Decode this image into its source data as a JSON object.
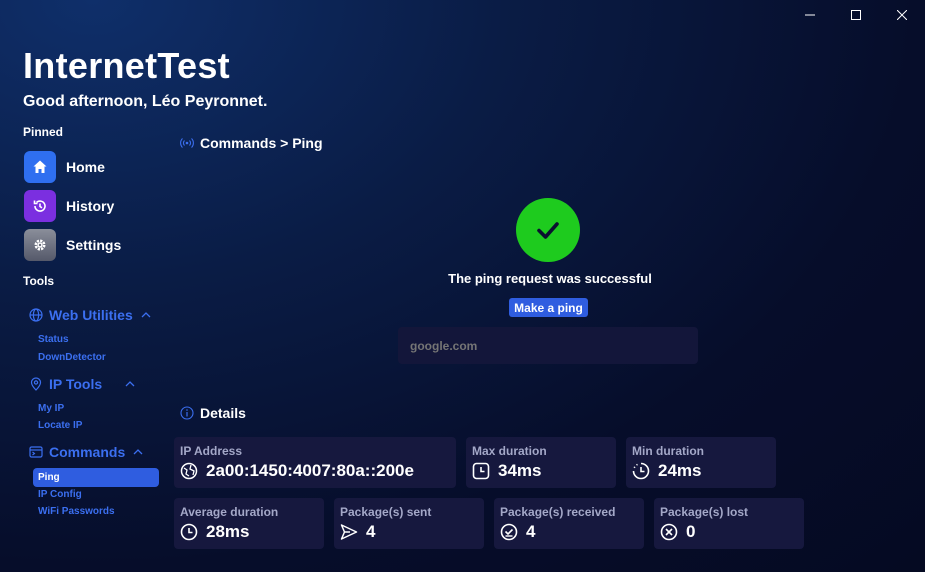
{
  "window": {
    "minimize_icon": "minimize-icon",
    "maximize_icon": "maximize-icon",
    "close_icon": "close-icon"
  },
  "app": {
    "title": "InternetTest",
    "greeting": "Good afternoon, Léo Peyronnet."
  },
  "sidebar": {
    "pinned_label": "Pinned",
    "pinned": [
      {
        "label": "Home",
        "icon": "home-icon",
        "color": "#2f6ff0"
      },
      {
        "label": "History",
        "icon": "history-icon",
        "color": "#7b2fe0"
      },
      {
        "label": "Settings",
        "icon": "gear-icon",
        "color": "#6b6f7c"
      }
    ],
    "tools_label": "Tools",
    "groups": [
      {
        "label": "Web Utilities",
        "icon": "globe-icon",
        "items": [
          "Status",
          "DownDetector"
        ]
      },
      {
        "label": "IP Tools",
        "icon": "location-pin-icon",
        "items": [
          "My IP",
          "Locate IP"
        ]
      },
      {
        "label": "Commands",
        "icon": "command-icon",
        "items": [
          "Ping",
          "IP Config",
          "WiFi Passwords"
        ]
      }
    ],
    "active_item": "Ping"
  },
  "main": {
    "breadcrumb": "Commands > Ping",
    "success_text": "The ping request was successful",
    "ping_button": "Make a ping",
    "host_placeholder": "google.com",
    "details_title": "Details",
    "cards": [
      {
        "label": "IP Address",
        "value": "2a00:1450:4007:80a::200e",
        "icon": "network-icon"
      },
      {
        "label": "Max duration",
        "value": "34ms",
        "icon": "clock-square-icon"
      },
      {
        "label": "Min duration",
        "value": "24ms",
        "icon": "clock-dashed-icon"
      },
      {
        "label": "Average duration",
        "value": "28ms",
        "icon": "clock-icon"
      },
      {
        "label": "Package(s) sent",
        "value": "4",
        "icon": "send-icon"
      },
      {
        "label": "Package(s) received",
        "value": "4",
        "icon": "received-icon"
      },
      {
        "label": "Package(s) lost",
        "value": "0",
        "icon": "x-circle-icon"
      }
    ]
  },
  "colors": {
    "accent": "#2f5de0",
    "success": "#1ecb1e",
    "card_bg": "#16183e",
    "link": "#3b6ff0"
  }
}
